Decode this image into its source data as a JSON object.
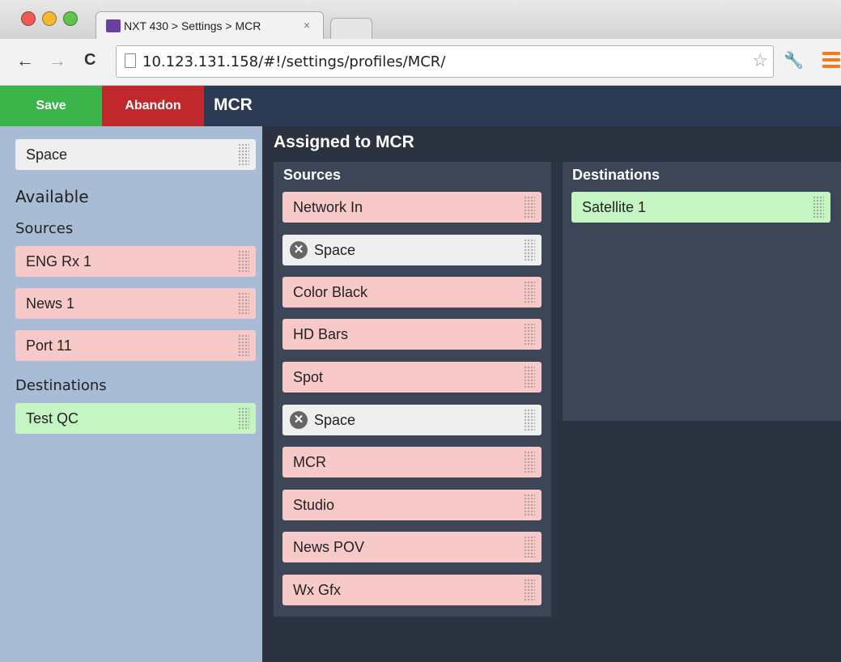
{
  "browser": {
    "tab_title": "NXT 430 > Settings > MCR",
    "tab_close": "×",
    "url": "10.123.131.158/#!/settings/profiles/MCR/",
    "back": "←",
    "forward": "→",
    "reload": "C",
    "star": "☆",
    "wrench": "🔧",
    "icons": [
      "back-icon",
      "forward-icon",
      "reload-icon",
      "star-icon",
      "wrench-icon",
      "menu-icon"
    ],
    "traffic_colors": [
      "#ee5b52",
      "#f4b731",
      "#5fc44b"
    ]
  },
  "header": {
    "save_label": "Save",
    "abandon_label": "Abandon",
    "profile_name": "MCR",
    "colors": {
      "save": "#3bb54a",
      "abandon": "#c0282e",
      "bar": "#2b3a52"
    }
  },
  "left": {
    "space_item": "Space",
    "available_title": "Available",
    "sources_title": "Sources",
    "sources": [
      "ENG Rx 1",
      "News 1",
      "Port 11"
    ],
    "destinations_title": "Destinations",
    "destinations": [
      "Test QC"
    ]
  },
  "assigned": {
    "title": "Assigned to MCR",
    "sources_title": "Sources",
    "sources": [
      "Network In",
      "Space",
      "Color Black",
      "HD Bars",
      "Spot",
      "Space",
      "MCR",
      "Studio",
      "News POV",
      "Wx Gfx"
    ],
    "remove_icon": "✕",
    "destinations_title": "Destinations",
    "destinations": [
      "Satellite 1"
    ]
  },
  "colors": {
    "source_item": "#f8c9c9",
    "destination_item": "#c6f5c4",
    "space_item": "#efefef",
    "left_panel": "#a9bcd6",
    "main_bg": "#2b3240",
    "column_bg": "#3d4656"
  }
}
